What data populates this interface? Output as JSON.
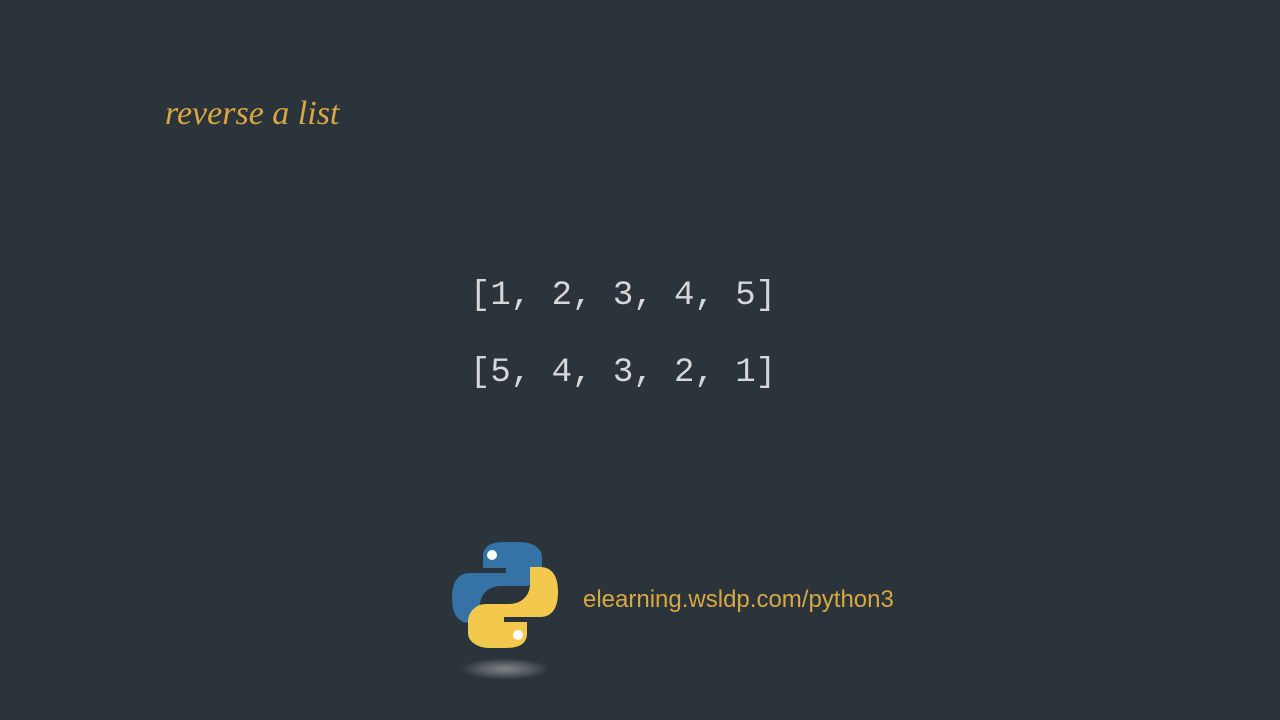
{
  "title": "reverse a list",
  "code": {
    "line1": "[1, 2, 3, 4, 5]",
    "line2": "[5, 4, 3, 2, 1]"
  },
  "footer": {
    "url": "elearning.wsldp.com/python3",
    "logo_name": "python-logo"
  }
}
